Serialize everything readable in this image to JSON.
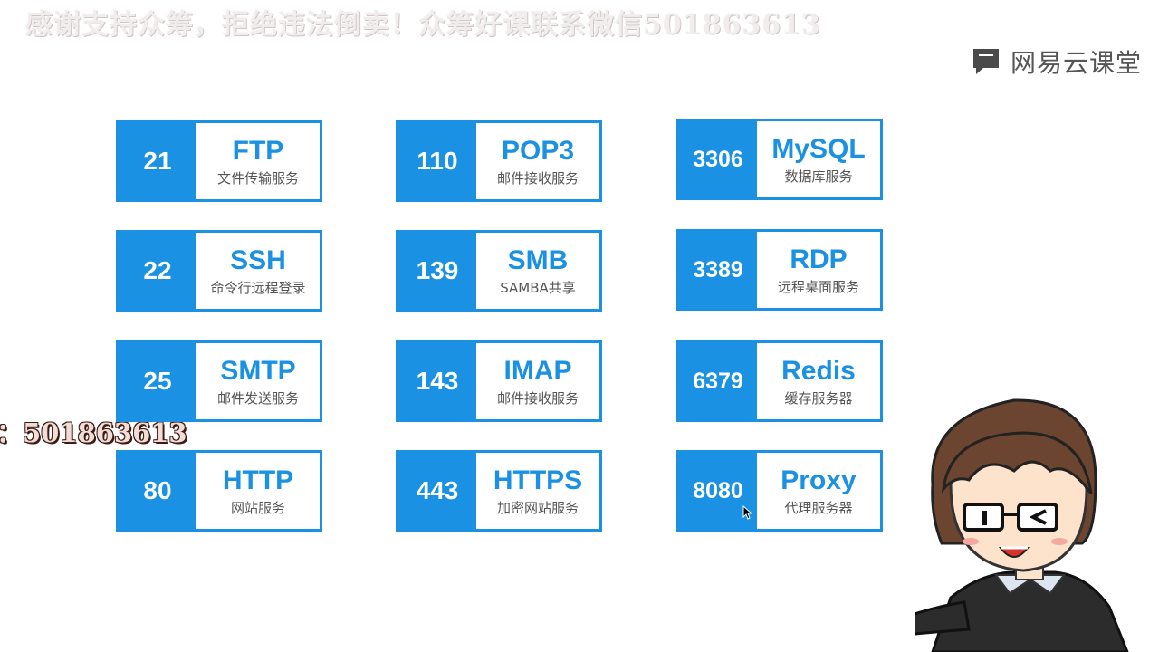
{
  "watermark_top": "感谢支持众筹，拒绝违法倒卖！众筹好课联系微信501863613",
  "watermark_side": "：501863613",
  "brand": {
    "name": "网易云课堂",
    "icon": "chat-bubble-logo-icon"
  },
  "cards": [
    {
      "port": "21",
      "protocol": "FTP",
      "description": "文件传输服务"
    },
    {
      "port": "110",
      "protocol": "POP3",
      "description": "邮件接收服务"
    },
    {
      "port": "3306",
      "protocol": "MySQL",
      "description": "数据库服务"
    },
    {
      "port": "22",
      "protocol": "SSH",
      "description": "命令行远程登录"
    },
    {
      "port": "139",
      "protocol": "SMB",
      "description": "SAMBA共享"
    },
    {
      "port": "3389",
      "protocol": "RDP",
      "description": "远程桌面服务"
    },
    {
      "port": "25",
      "protocol": "SMTP",
      "description": "邮件发送服务"
    },
    {
      "port": "143",
      "protocol": "IMAP",
      "description": "邮件接收服务"
    },
    {
      "port": "6379",
      "protocol": "Redis",
      "description": "缓存服务器"
    },
    {
      "port": "80",
      "protocol": "HTTP",
      "description": "网站服务"
    },
    {
      "port": "443",
      "protocol": "HTTPS",
      "description": "加密网站服务"
    },
    {
      "port": "8080",
      "protocol": "Proxy",
      "description": "代理服务器"
    }
  ],
  "colors": {
    "accent": "#1a91e2",
    "watermark": "#f1eded"
  }
}
